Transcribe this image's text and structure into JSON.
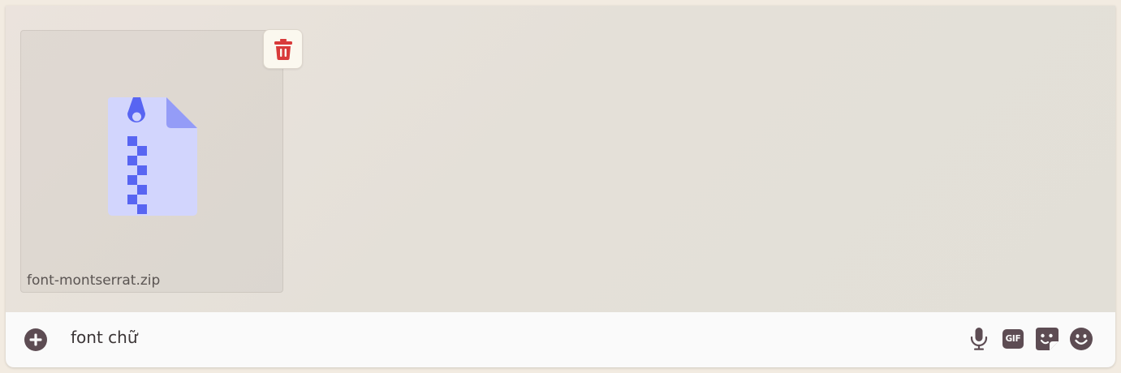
{
  "attachments": [
    {
      "file_name": "font-montserrat.zip",
      "icon": "zip-file-icon",
      "delete_icon": "trash-icon"
    }
  ],
  "composer": {
    "message_text": "font chữ",
    "add_icon": "plus-circle-icon",
    "actions": [
      {
        "name": "microphone-icon"
      },
      {
        "name": "gif-icon",
        "label": "GIF"
      },
      {
        "name": "sticker-icon"
      },
      {
        "name": "emoji-icon"
      }
    ]
  },
  "colors": {
    "icon_dark": "#5d4c53",
    "delete_red": "#d83a3a",
    "zip_light": "#d2d5fd",
    "zip_accent": "#5865f2",
    "zip_fold": "#949cf7"
  }
}
